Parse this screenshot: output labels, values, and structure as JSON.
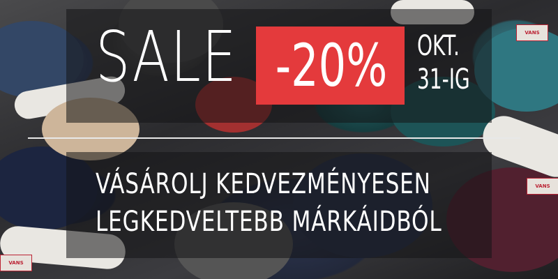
{
  "banner": {
    "headline": "SALE",
    "discount": "-20%",
    "date_line1": "OKT.",
    "date_line2": "31-IG",
    "tagline_line1": "VÁSÁROLJ KEDVEZMÉNYESEN",
    "tagline_line2": "LEGKEDVELTEBB MÁRKÁIDBÓL"
  },
  "colors": {
    "accent": "#e43a3c",
    "text": "#ffffff",
    "overlay": "#141416"
  }
}
